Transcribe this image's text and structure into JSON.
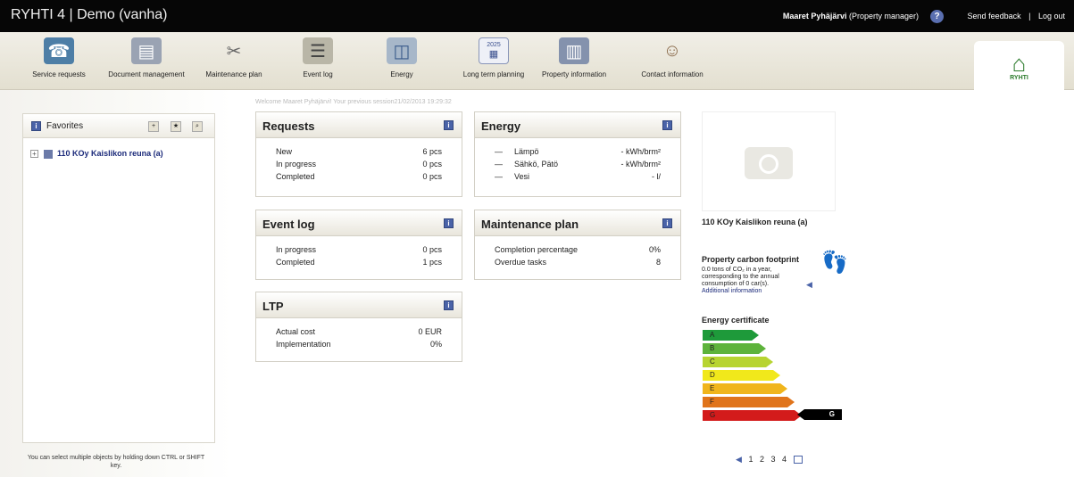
{
  "app": {
    "title": "RYHTI 4  |  Demo (vanha)",
    "user_name": "Maaret Pyhäjärvi",
    "user_role": "(Property manager)",
    "help_icon": "question-icon",
    "send_feedback": "Send feedback",
    "separator": "|",
    "log_out": "Log out"
  },
  "toolbar": {
    "items": [
      {
        "label": "Service requests",
        "icon": "telephone-icon"
      },
      {
        "label": "Document management",
        "icon": "folder-icon"
      },
      {
        "label": "Maintenance plan",
        "icon": "tools-icon"
      },
      {
        "label": "Event log",
        "icon": "logbook-icon"
      },
      {
        "label": "Energy",
        "icon": "energy-chart-icon"
      },
      {
        "label": "Long term planning",
        "icon": "calendar-icon"
      },
      {
        "label": "Property information",
        "icon": "building-icon"
      },
      {
        "label": "Contact information",
        "icon": "person-icon"
      }
    ],
    "calendar_year": "2025",
    "logo_text": "RYHTI"
  },
  "favorites": {
    "title": "Favorites",
    "item": "110 KOy Kaislikon reuna (a)",
    "hint": "You can select multiple objects by holding down CTRL or SHIFT key."
  },
  "welcome": "Welcome Maaret Pyhäjärvi! Your previous session21/02/2013 19:29:32",
  "requests": {
    "title": "Requests",
    "rows": [
      {
        "label": "New",
        "value": "6 pcs"
      },
      {
        "label": "In progress",
        "value": "0 pcs"
      },
      {
        "label": "Completed",
        "value": "0 pcs"
      }
    ]
  },
  "energy": {
    "title": "Energy",
    "rows": [
      {
        "label": "Lämpö",
        "value": "- kWh/brm²"
      },
      {
        "label": "Sähkö, Pätö",
        "value": "- kWh/brm²"
      },
      {
        "label": "Vesi",
        "value": "- l/"
      }
    ]
  },
  "eventlog": {
    "title": "Event log",
    "rows": [
      {
        "label": "In progress",
        "value": "0 pcs"
      },
      {
        "label": "Completed",
        "value": "1 pcs"
      }
    ]
  },
  "maintenance": {
    "title": "Maintenance plan",
    "rows": [
      {
        "label": "Completion percentage",
        "value": "0%"
      },
      {
        "label": "Overdue tasks",
        "value": "8"
      }
    ]
  },
  "ltp": {
    "title": "LTP",
    "rows": [
      {
        "label": "Actual cost",
        "value": "0 EUR"
      },
      {
        "label": "Implementation",
        "value": "0%"
      }
    ]
  },
  "property": {
    "name": "110 KOy Kaislikon reuna (a)",
    "carbon_title": "Property carbon footprint",
    "carbon_text_1": "0.0 tons of CO₂ in a year,",
    "carbon_text_2": "corresponding to the annual",
    "carbon_text_3": "consumption of 0 car(s).",
    "carbon_link": "Additional information",
    "energy_cert_title": "Energy certificate",
    "classes": [
      {
        "label": "A",
        "color": "#1e9a3a"
      },
      {
        "label": "B",
        "color": "#5db33b"
      },
      {
        "label": "C",
        "color": "#b7d431"
      },
      {
        "label": "D",
        "color": "#f1e81b"
      },
      {
        "label": "E",
        "color": "#f0b51c"
      },
      {
        "label": "F",
        "color": "#e0741b"
      },
      {
        "label": "G",
        "color": "#d31b1b"
      }
    ],
    "selected_class": "G"
  },
  "pager": {
    "pages": [
      "1",
      "2",
      "3",
      "4"
    ]
  }
}
